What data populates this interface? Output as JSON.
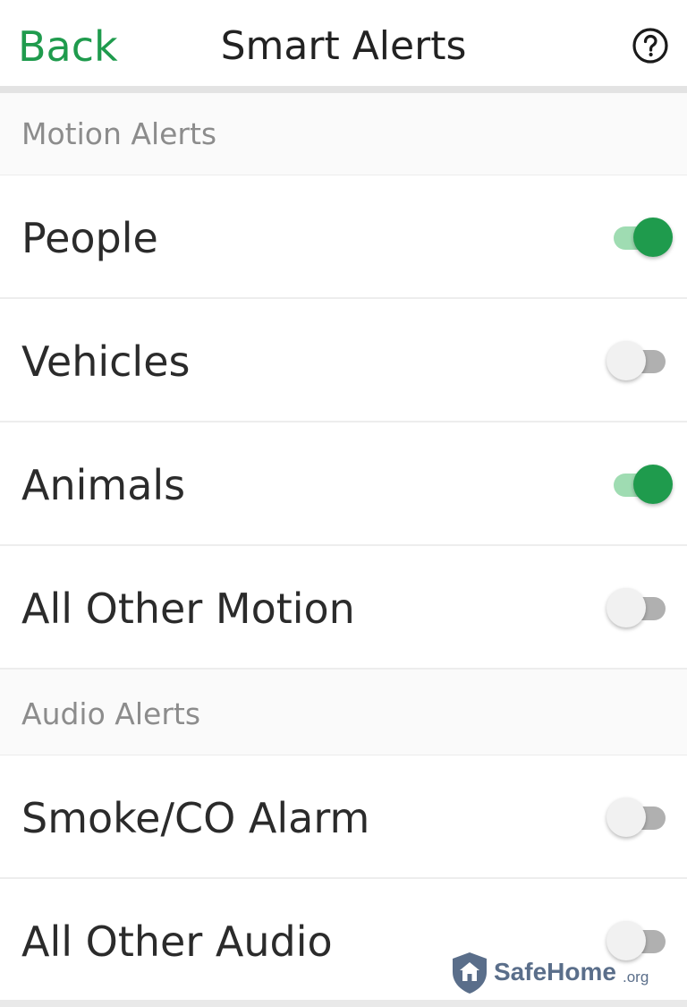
{
  "header": {
    "back_label": "Back",
    "title": "Smart Alerts",
    "help_icon": "help-circle-icon"
  },
  "sections": [
    {
      "title": "Motion Alerts",
      "items": [
        {
          "label": "People",
          "enabled": true
        },
        {
          "label": "Vehicles",
          "enabled": false
        },
        {
          "label": "Animals",
          "enabled": true
        },
        {
          "label": "All Other Motion",
          "enabled": false
        }
      ]
    },
    {
      "title": "Audio Alerts",
      "items": [
        {
          "label": "Smoke/CO Alarm",
          "enabled": false
        },
        {
          "label": "All Other Audio",
          "enabled": false
        }
      ]
    }
  ],
  "watermark": {
    "brand": "SafeHome",
    "tld": ".org",
    "icon": "house-shield-icon"
  },
  "colors": {
    "accent": "#1f9b4d",
    "accent_light": "#9fdcb2",
    "toggle_off_track": "#b0b0b0",
    "section_header_text": "#8c8c8c",
    "watermark": "#5a6e8a"
  }
}
